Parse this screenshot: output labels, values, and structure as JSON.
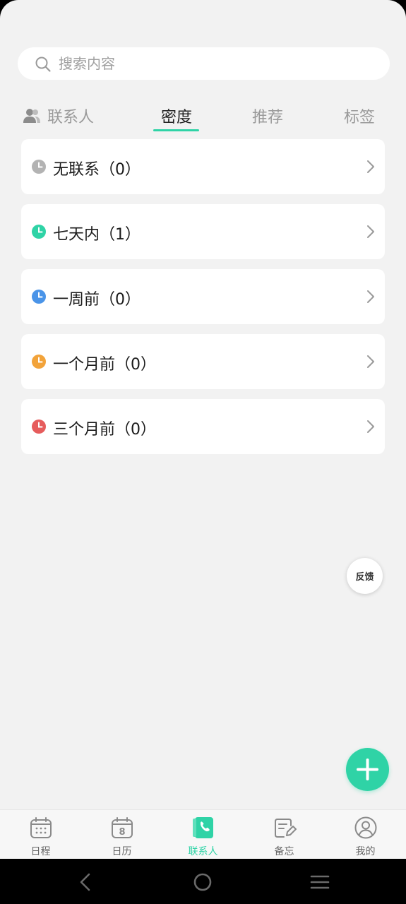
{
  "search": {
    "placeholder": "搜索内容",
    "value": ""
  },
  "tabs": [
    {
      "label": "联系人",
      "icon": "contacts-icon",
      "active": false
    },
    {
      "label": "密度",
      "active": true
    },
    {
      "label": "推荐",
      "active": false
    },
    {
      "label": "标签",
      "active": false
    }
  ],
  "groups": [
    {
      "label": "无联系（0）",
      "count": 0,
      "color": "#b3b3b3",
      "icon": "clock-icon"
    },
    {
      "label": "七天内（1）",
      "count": 1,
      "color": "#2fd3a6",
      "icon": "clock-icon"
    },
    {
      "label": "一周前（0）",
      "count": 0,
      "color": "#4a94e8",
      "icon": "clock-icon"
    },
    {
      "label": "一个月前（0）",
      "count": 0,
      "color": "#f2a33a",
      "icon": "clock-icon"
    },
    {
      "label": "三个月前（0）",
      "count": 0,
      "color": "#e65c5c",
      "icon": "clock-icon"
    }
  ],
  "feedback": {
    "label": "反馈"
  },
  "fab": {
    "icon": "plus-icon"
  },
  "bottom_nav": [
    {
      "label": "日程",
      "icon": "schedule-icon",
      "active": false
    },
    {
      "label": "日历",
      "icon": "calendar-icon",
      "active": false,
      "icon_text": "8"
    },
    {
      "label": "联系人",
      "icon": "phone-book-icon",
      "active": true
    },
    {
      "label": "备忘",
      "icon": "memo-icon",
      "active": false
    },
    {
      "label": "我的",
      "icon": "profile-icon",
      "active": false
    }
  ],
  "system_nav": [
    "back-icon",
    "home-icon",
    "menu-icon"
  ],
  "colors": {
    "accent": "#2fd3a6",
    "background": "#f2f2f2"
  }
}
